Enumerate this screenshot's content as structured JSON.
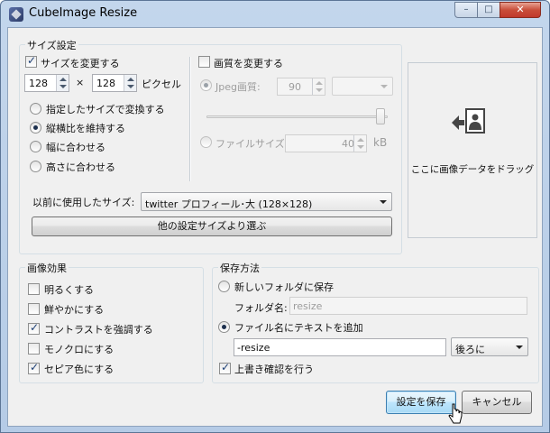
{
  "window": {
    "title": "CubeImage Resize"
  },
  "size_group": {
    "title": "サイズ設定",
    "change_size_label": "サイズを変更する",
    "change_size_checked": true,
    "width_value": "128",
    "times_symbol": "×",
    "height_value": "128",
    "pixel_label": "ピクセル",
    "mode_options": [
      "指定したサイズで変換する",
      "縦横比を維持する",
      "幅に合わせる",
      "高さに合わせる"
    ],
    "mode_selected": "縦横比を維持する",
    "recent_label": "以前に使用したサイズ:",
    "recent_value": "twitter プロフィール･大 (128×128)",
    "choose_button": "他の設定サイズより選ぶ"
  },
  "quality": {
    "change_quality_label": "画質を変更する",
    "change_quality_checked": false,
    "jpeg_label": "Jpeg画質:",
    "jpeg_value": "90",
    "slider_level": 100,
    "filesize_label": "ファイルサイズ:",
    "filesize_value": "40",
    "filesize_unit": "kB"
  },
  "drop_zone": {
    "label": "ここに画像データをドラッグ",
    "icon": "drop-image-icon"
  },
  "effects": {
    "title": "画像効果",
    "items": [
      {
        "label": "明るくする",
        "checked": false
      },
      {
        "label": "鮮やかにする",
        "checked": false
      },
      {
        "label": "コントラストを強調する",
        "checked": true
      },
      {
        "label": "モノクロにする",
        "checked": false
      },
      {
        "label": "セピア色にする",
        "checked": true
      }
    ]
  },
  "save_method": {
    "title": "保存方法",
    "new_folder_label": "新しいフォルダに保存",
    "folder_name_label": "フォルダ名:",
    "folder_name_value": "resize",
    "append_text_label": "ファイル名にテキストを追加",
    "selected": "append",
    "suffix_value": "-resize",
    "position_value": "後ろに",
    "confirm_overwrite_label": "上書き確認を行う",
    "confirm_overwrite_checked": true
  },
  "buttons": {
    "save": "設定を保存",
    "cancel": "キャンセル"
  },
  "caption_buttons": {
    "minimize": "–",
    "maximize": "□",
    "close": "✕"
  },
  "colors": {
    "accent": "#3c7fb1",
    "title_bg": "#c3d6ec",
    "close": "#c94e3a"
  }
}
